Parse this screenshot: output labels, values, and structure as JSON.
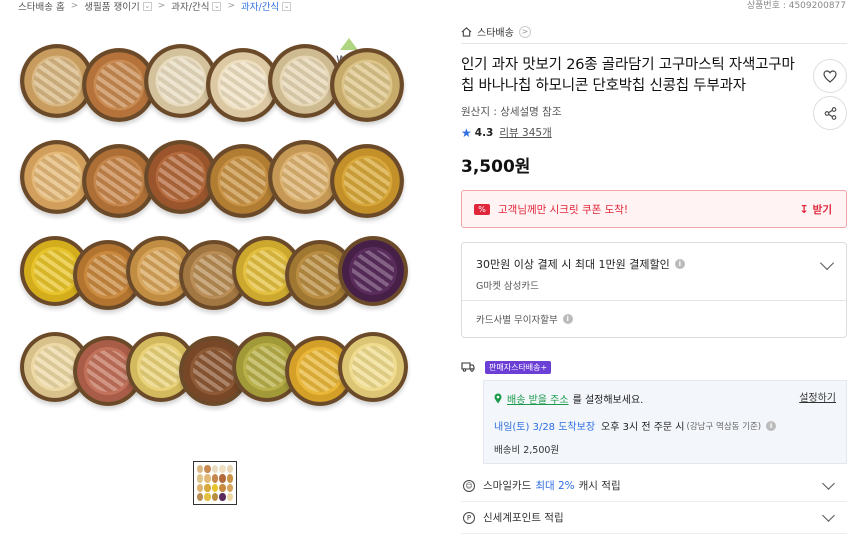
{
  "breadcrumb": {
    "items": [
      "스타배송 홈",
      "생필품 쟁이기",
      "과자/간식",
      "과자/간식"
    ]
  },
  "product_number": "상품번호 : 4509200877",
  "gallery": {
    "watermark": "wooriga",
    "bowl_colors": [
      [
        "#d9b884",
        "#c79c5e"
      ],
      [
        "#c98b52",
        "#b5733b"
      ],
      [
        "#e9dcc0",
        "#d4c29c"
      ],
      [
        "#efe0c2",
        "#dcc9a3"
      ],
      [
        "#e6d6b4",
        "#cfbb92"
      ],
      [
        "#ddc58a",
        "#c6ab6b"
      ],
      [
        "#e4b978",
        "#d19f5b"
      ],
      [
        "#c7874c",
        "#ad6f36"
      ],
      [
        "#b46a3c",
        "#9a552c"
      ],
      [
        "#c99447",
        "#b17d33"
      ],
      [
        "#ddb371",
        "#c59955"
      ],
      [
        "#d8a83a",
        "#c3902a"
      ],
      [
        "#e8c42c",
        "#d4ad1c"
      ],
      [
        "#c9893f",
        "#b3742f"
      ],
      [
        "#d7a55b",
        "#c18d43"
      ],
      [
        "#b98d55",
        "#a37741"
      ],
      [
        "#e3c040",
        "#cda82e"
      ],
      [
        "#b98d42",
        "#a17832"
      ],
      [
        "#5a2c5c",
        "#472048"
      ],
      [
        "#edd9a5",
        "#d8c18b"
      ],
      [
        "#c2725a",
        "#a95c47"
      ],
      [
        "#e9d27a",
        "#d4ba5e"
      ],
      [
        "#8e5a35",
        "#774727"
      ],
      [
        "#b9b04a",
        "#a29938"
      ],
      [
        "#e9b73a",
        "#d4a028"
      ],
      [
        "#f0dc8f",
        "#dcc675"
      ]
    ]
  },
  "store": {
    "label": "스타배송"
  },
  "product": {
    "title": "인기 과자 맛보기 26종 골라담기 고구마스틱 자색고구마칩 바나나칩 하모니콘 단호박칩 신콩칩 두부과자",
    "origin": "원산지 : 상세설명 참조",
    "rating": "4.3",
    "reviews": "리뷰 345개",
    "price": "3,500원"
  },
  "coupon": {
    "icon_text": "%",
    "text": "고객님께만 시크릿 쿠폰 도착!",
    "get_label": "받기"
  },
  "card_benefit": {
    "title": "30만원 이상 결제 시 최대 1만원 결제할인",
    "sub": "G마켓 삼성카드",
    "installment": "카드사별 무이자할부"
  },
  "shipping": {
    "badge": "판매자스타배송+",
    "address_link": "배송 받을 주소",
    "address_rest": "를 설정해보세요.",
    "set_label": "설정하기",
    "date": "내일(토) 3/28 도착보장",
    "cutoff": "오후 3시 전 주문 시",
    "region": "(강남구 역삼동 기준)",
    "fee": "배송비 2,500원"
  },
  "smilecard": {
    "pre": "스마일카드",
    "highlight": "최대 2%",
    "post": "캐시 적립"
  },
  "shinsegae": {
    "label": "신세계포인트 적립"
  }
}
